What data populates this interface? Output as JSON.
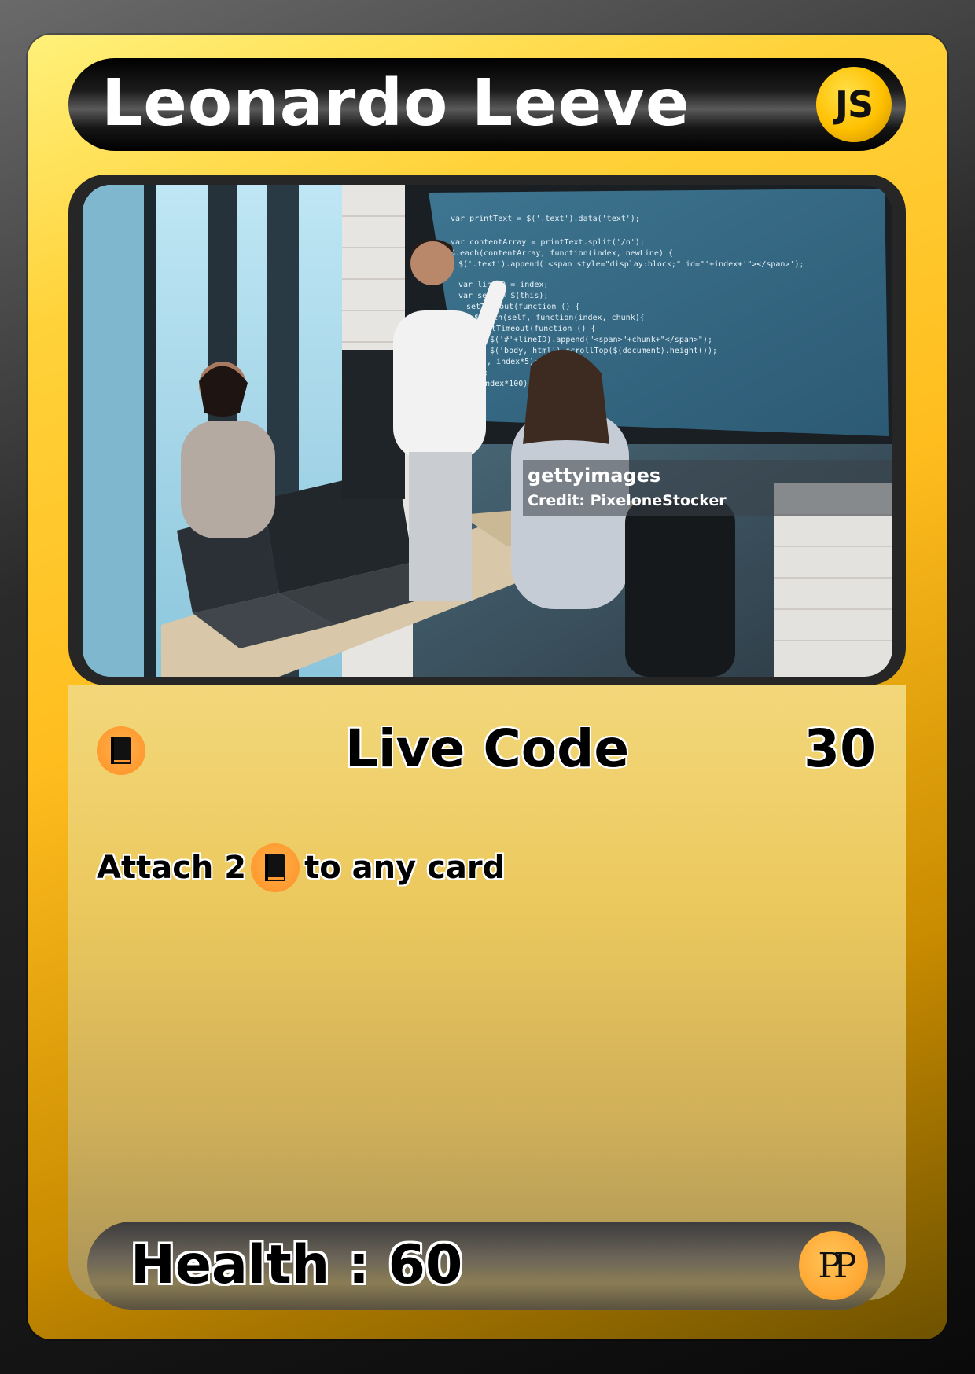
{
  "card": {
    "name": "Leonardo Leeve",
    "type_badge": "JS",
    "image": {
      "watermark_brand": "gettyimages",
      "credit": "Credit: PixeloneStocker",
      "screen_code": [
        "var printText = $('.text').data('text');",
        "var contentArray = printText.split('/n');",
        "$.each(contentArray, function(index, newLine) {",
        "  $('.text').append('<span style=\"display:block;\" id=\"'+index+'\"></span>');",
        "  var lineID = index;",
        "  var self = $(this);",
        "  setTimeout(function () {",
        "    $.each(self, function(index, chunk){",
        "      setTimeout(function () {",
        "        $('#'+lineID).append(\"<span>\"+chunk+\"</span>\");",
        "        $('body, html').scrollTop($(document).height());",
        "      }, index*5);",
        "    });",
        "  }, index*100);"
      ]
    },
    "attack": {
      "cost_icon": "book-icon",
      "name": "Live Code",
      "damage": "30",
      "effect_prefix": "Attach 2",
      "effect_suffix": "to any card"
    },
    "health_label": "Health : 60",
    "set_logo": "PP"
  },
  "colors": {
    "card_gold": "#ffbd1e",
    "energy_orange": "#ff9a30",
    "name_bar": "#000000"
  }
}
